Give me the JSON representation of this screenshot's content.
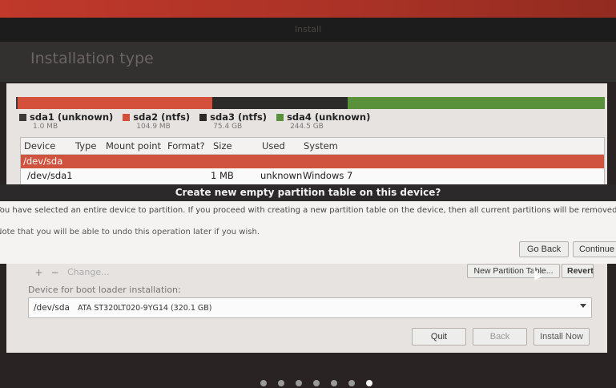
{
  "window": {
    "title": "Install"
  },
  "page": {
    "heading": "Installation type"
  },
  "partitions": {
    "segments": [
      {
        "color": "#3c3a38",
        "fraction": 0.003
      },
      {
        "color": "#d4503a",
        "fraction": 0.33
      },
      {
        "color": "#2c2b2a",
        "fraction": 0.23
      },
      {
        "color": "#59913b",
        "fraction": 0.437
      }
    ],
    "legend": [
      {
        "name": "sda1 (unknown)",
        "size": "1.0 MB",
        "color": "#3c3a38"
      },
      {
        "name": "sda2 (ntfs)",
        "size": "104.9 MB",
        "color": "#d4503a"
      },
      {
        "name": "sda3 (ntfs)",
        "size": "75.4 GB",
        "color": "#2c2b2a"
      },
      {
        "name": "sda4 (unknown)",
        "size": "244.5 GB",
        "color": "#59913b"
      }
    ]
  },
  "table": {
    "headers": {
      "device": "Device",
      "type": "Type",
      "mount": "Mount point",
      "format": "Format?",
      "size": "Size",
      "used": "Used",
      "system": "System"
    },
    "selected_row": "/dev/sda",
    "row": {
      "device": "/dev/sda1",
      "size": "1 MB",
      "used": "unknown",
      "system": "Windows 7"
    }
  },
  "dialog": {
    "title": "Create new empty partition table on this device?",
    "message": "You have selected an entire device to partition. If you proceed with creating a new partition table on the device, then all current partitions will be removed.",
    "note": "Note that you will be able to undo this operation later if you wish.",
    "go_back": "Go Back",
    "continue": "Continue"
  },
  "controls": {
    "add": "+",
    "remove": "−",
    "change": "Change...",
    "new_table": "New Partition Table...",
    "revert": "Revert"
  },
  "boot": {
    "label": "Device for boot loader installation:",
    "device": "/dev/sda",
    "model": "ATA ST320LT020-9YG14 (320.1 GB)"
  },
  "nav": {
    "quit": "Quit",
    "back": "Back",
    "install_now": "Install Now"
  },
  "progress": {
    "steps": 7,
    "current": 6
  }
}
